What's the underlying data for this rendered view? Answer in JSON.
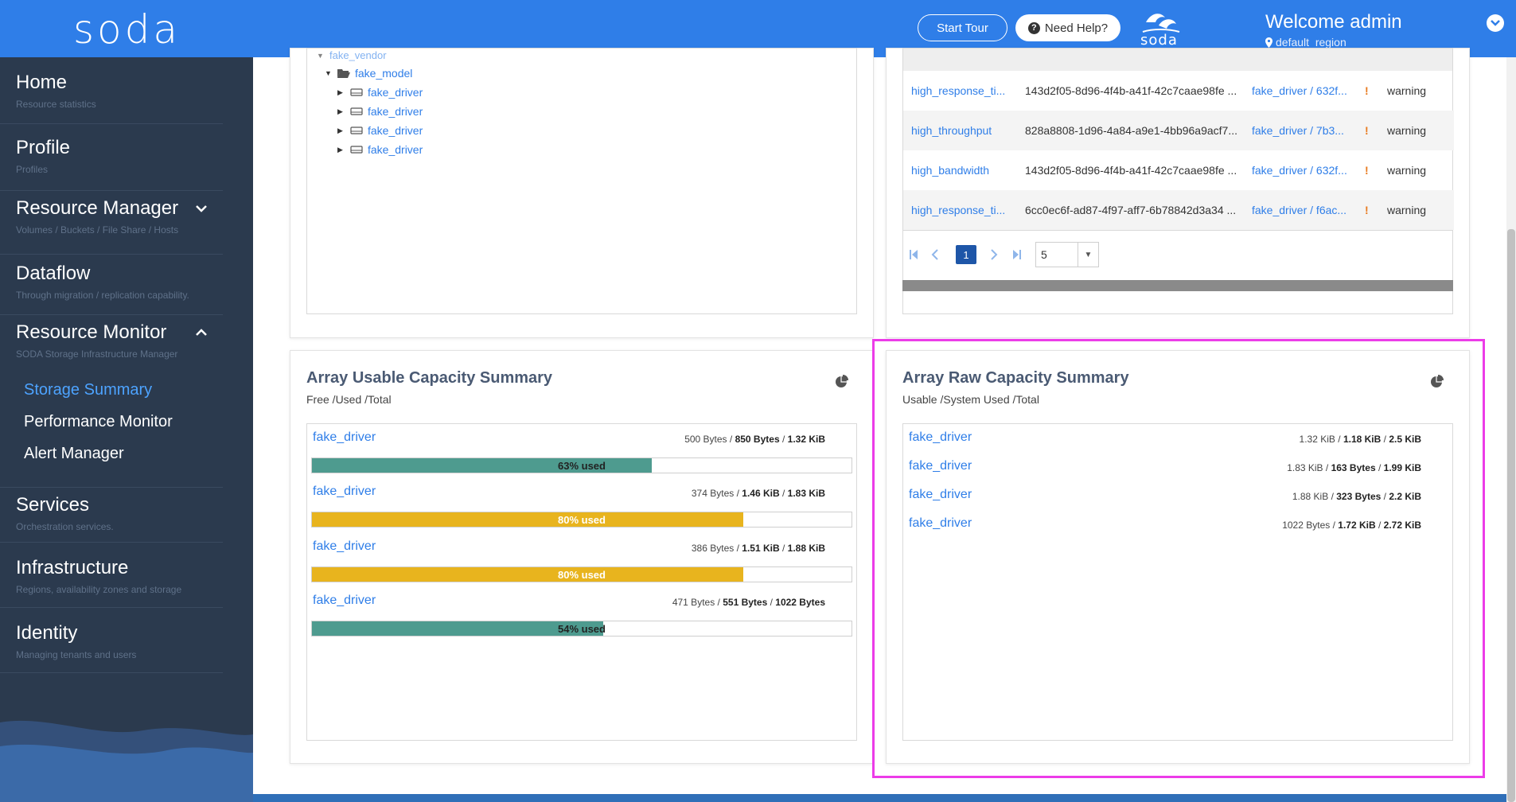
{
  "header": {
    "logo": "soda",
    "start_tour": "Start Tour",
    "need_help": "Need Help?",
    "brand": "soda",
    "welcome": "Welcome admin",
    "region": "default_region",
    "accent": "#2f7ee8"
  },
  "sidebar": {
    "items": [
      {
        "title": "Home",
        "sub": "Resource statistics"
      },
      {
        "title": "Profile",
        "sub": "Profiles"
      },
      {
        "title": "Resource Manager",
        "sub": "Volumes / Buckets / File Share / Hosts"
      },
      {
        "title": "Dataflow",
        "sub": "Through migration / replication capability."
      },
      {
        "title": "Resource Monitor",
        "sub": "SODA Storage Infrastructure Manager"
      },
      {
        "title": "Services",
        "sub": "Orchestration services."
      },
      {
        "title": "Infrastructure",
        "sub": "Regions, availability zones and storage"
      },
      {
        "title": "Identity",
        "sub": "Managing tenants and users"
      }
    ],
    "resource_monitor_sub": [
      "Storage Summary",
      "Performance Monitor",
      "Alert Manager"
    ]
  },
  "tree": {
    "partial": "fake_vendor",
    "model": "fake_model",
    "drivers": [
      "fake_driver",
      "fake_driver",
      "fake_driver",
      "fake_driver"
    ]
  },
  "alerts": {
    "rows": [
      {
        "name": "high_response_ti...",
        "id": "143d2f05-8d96-4f4b-a41f-42c7caae98fe ...",
        "resource": "fake_driver / 632f...",
        "severity": "warning"
      },
      {
        "name": "high_throughput",
        "id": "828a8808-1d96-4a84-a9e1-4bb96a9acf7...",
        "resource": "fake_driver / 7b3...",
        "severity": "warning"
      },
      {
        "name": "high_bandwidth",
        "id": "143d2f05-8d96-4f4b-a41f-42c7caae98fe ...",
        "resource": "fake_driver / 632f...",
        "severity": "warning"
      },
      {
        "name": "high_response_ti...",
        "id": "6cc0ec6f-ad87-4f97-aff7-6b78842d3a34 ...",
        "resource": "fake_driver / f6ac...",
        "severity": "warning"
      }
    ],
    "exclamation": "!",
    "page": "1",
    "page_size": "5"
  },
  "usable": {
    "title": "Array Usable Capacity Summary",
    "subtitle": "Free /Used /Total",
    "rows": [
      {
        "name": "fake_driver",
        "free": "500 Bytes",
        "used": "850 Bytes",
        "total": "1.32 KiB",
        "percent": 63,
        "label": "63% used",
        "color": "#4e9b8f"
      },
      {
        "name": "fake_driver",
        "free": "374 Bytes",
        "used": "1.46 KiB",
        "total": "1.83 KiB",
        "percent": 80,
        "label": "80% used",
        "color": "#e8b41e"
      },
      {
        "name": "fake_driver",
        "free": "386 Bytes",
        "used": "1.51 KiB",
        "total": "1.88 KiB",
        "percent": 80,
        "label": "80% used",
        "color": "#e8b41e"
      },
      {
        "name": "fake_driver",
        "free": "471 Bytes",
        "used": "551 Bytes",
        "total": "1022 Bytes",
        "percent": 54,
        "label": "54% used",
        "color": "#4e9b8f"
      }
    ]
  },
  "raw": {
    "title": "Array Raw Capacity Summary",
    "subtitle": "Usable /System Used /Total",
    "rows": [
      {
        "name": "fake_driver",
        "usable": "1.32 KiB",
        "system": "1.18 KiB",
        "total": "2.5 KiB"
      },
      {
        "name": "fake_driver",
        "usable": "1.83 KiB",
        "system": "163 Bytes",
        "total": "1.99 KiB"
      },
      {
        "name": "fake_driver",
        "usable": "1.88 KiB",
        "system": "323 Bytes",
        "total": "2.2 KiB"
      },
      {
        "name": "fake_driver",
        "usable": "1022 Bytes",
        "system": "1.72 KiB",
        "total": "2.72 KiB"
      }
    ]
  }
}
